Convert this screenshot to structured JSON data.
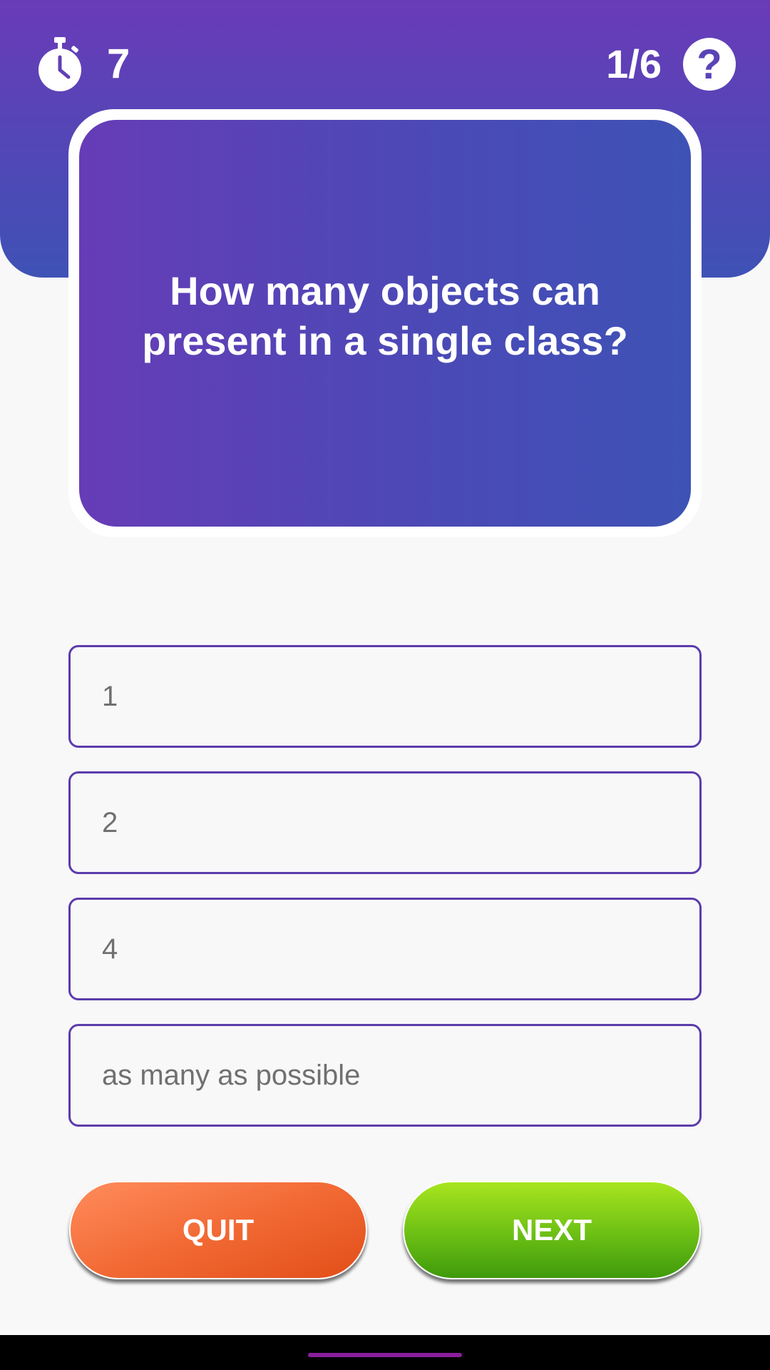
{
  "header": {
    "timer_value": "7",
    "progress_text": "1/6",
    "timer_icon": "stopwatch-icon",
    "help_icon": "question-mark-icon",
    "help_glyph": "?"
  },
  "question": {
    "text": "How many objects can present in a single class?"
  },
  "options": [
    {
      "label": "1"
    },
    {
      "label": "2"
    },
    {
      "label": "4"
    },
    {
      "label": "as many as possible"
    }
  ],
  "buttons": {
    "quit_label": "QUIT",
    "next_label": "NEXT"
  },
  "colors": {
    "header_top": "#6a3bb8",
    "header_bottom": "#3f52b5",
    "option_border": "#5c3cab",
    "option_text": "#707070",
    "quit_button": "#f26a35",
    "next_button": "#6cbf14",
    "background": "#f8f8f9"
  }
}
